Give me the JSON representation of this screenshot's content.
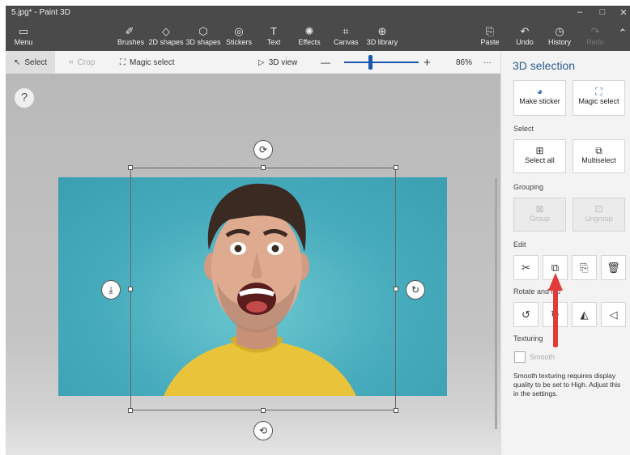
{
  "window": {
    "title": "5.jpg* - Paint 3D",
    "controls": [
      "–",
      "□",
      "✕"
    ]
  },
  "ribbon": {
    "menu_label": "Menu",
    "tools": [
      {
        "label": "Brushes",
        "icon": "brush-icon"
      },
      {
        "label": "2D shapes",
        "icon": "2d-shapes-icon"
      },
      {
        "label": "3D shapes",
        "icon": "3d-shapes-icon"
      },
      {
        "label": "Stickers",
        "icon": "stickers-icon"
      },
      {
        "label": "Text",
        "icon": "text-icon"
      },
      {
        "label": "Effects",
        "icon": "effects-icon"
      },
      {
        "label": "Canvas",
        "icon": "canvas-icon"
      },
      {
        "label": "3D library",
        "icon": "3d-library-icon"
      }
    ],
    "paste_label": "Paste",
    "undo_label": "Undo",
    "history_label": "History",
    "redo_label": "Redo"
  },
  "toolbar": {
    "select_label": "Select",
    "crop_label": "Crop",
    "magic_select_label": "Magic select",
    "view_3d_label": "3D view",
    "zoom_minus": "—",
    "zoom_plus": "+",
    "zoom_value": "86%",
    "more": "···",
    "zoom_level_fraction": 0.35
  },
  "canvas": {
    "help": "?"
  },
  "panel": {
    "title": "3D selection",
    "make_sticker_label": "Make sticker",
    "magic_select_label": "Magic select",
    "select_section": "Select",
    "select_all_label": "Select all",
    "multiselect_label": "Multiselect",
    "grouping_section": "Grouping",
    "group_label": "Group",
    "ungroup_label": "Ungroup",
    "edit_section": "Edit",
    "rotate_section": "Rotate and flip",
    "texturing_section": "Texturing",
    "smooth_label": "Smooth",
    "note": "Smooth texturing requires display quality to be set to High. Adjust this in the settings."
  }
}
